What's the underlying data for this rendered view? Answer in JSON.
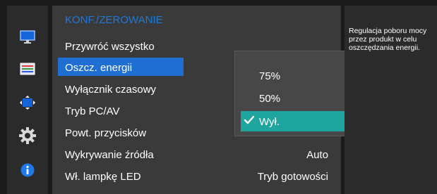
{
  "menu": {
    "title": "KONF./ZEROWANIE",
    "items": [
      {
        "label": "Przywróć wszystko",
        "value": ""
      },
      {
        "label": "Oszcz. energii",
        "value": ""
      },
      {
        "label": "Wyłącznik czasowy",
        "value": ""
      },
      {
        "label": "Tryb PC/AV",
        "value": ""
      },
      {
        "label": "Powt. przycisków",
        "value": ""
      },
      {
        "label": "Wykrywanie źródła",
        "value": "Auto"
      },
      {
        "label": "Wł. lampkę LED",
        "value": "Tryb gotowości"
      }
    ]
  },
  "popup": {
    "options": [
      {
        "label": "75%"
      },
      {
        "label": "50%"
      },
      {
        "label": "Wył."
      }
    ],
    "selected_mark": "✓"
  },
  "description": {
    "text": "Regulacja poboru mocy przez produkt w celu oszczędzania energii."
  },
  "icons": [
    "monitor-icon",
    "color-bars-icon",
    "size-position-icon",
    "settings-gear-icon",
    "info-icon"
  ],
  "colors": {
    "title": "#1e78d8",
    "highlight": "#1f6fd2",
    "popup_selected": "#1ea5a0"
  }
}
